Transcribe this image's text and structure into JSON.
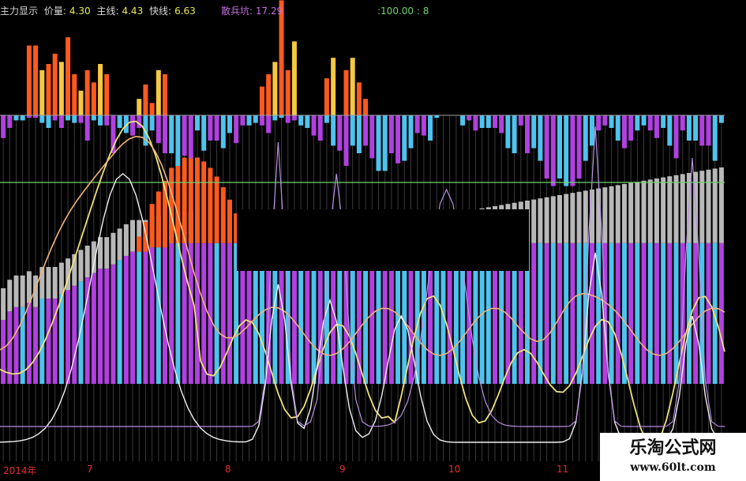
{
  "legend": {
    "title": "主力显示",
    "price_label": "价量:",
    "price_value": "4.30",
    "main_label": "主线:",
    "main_value": "4.43",
    "fast_label": "快线:",
    "fast_value": "6.63",
    "retail_label": "散兵坑:",
    "retail_value": "17.29",
    "ref_value": ":100.00 : 8"
  },
  "colors": {
    "background": "#000000",
    "bar_orange": "#ff5a1e",
    "bar_yellow": "#f5c842",
    "bar_cyan": "#4ec3ee",
    "bar_magenta": "#b040e0",
    "bar_gray": "#b8b8b8",
    "line_yellow": "#f0e27a",
    "line_peach": "#f2b47a",
    "line_white": "#f0f0f0",
    "line_violet": "#b890e0",
    "ref_line": "#6fd26f",
    "axis_labels": "#e03030"
  },
  "x_axis": {
    "labels": [
      "2014年",
      "7",
      "8",
      "9",
      "10",
      "11"
    ]
  },
  "watermark": {
    "line1": "乐淘公式网",
    "line2": "www.60lt.com"
  },
  "chart_data": {
    "type": "bar",
    "title": "主力显示",
    "n_bars": 112,
    "zero_line": 0,
    "ref_line": 100,
    "top_panel": {
      "description_series": "red/yellow bars above zero",
      "values": [
        0,
        0,
        0,
        0,
        34,
        34,
        22,
        25,
        30,
        26,
        38,
        20,
        12,
        22,
        16,
        25,
        20,
        0,
        0,
        0,
        0,
        8,
        15,
        6,
        22,
        20,
        0,
        0,
        0,
        0,
        0,
        0,
        0,
        0,
        0,
        0,
        0,
        0,
        0,
        0,
        14,
        20,
        26,
        56,
        22,
        36,
        0,
        0,
        0,
        0,
        18,
        28,
        0,
        22,
        28,
        16,
        8,
        0,
        0,
        0,
        0,
        0,
        0,
        0,
        0,
        0,
        0,
        0,
        0,
        0,
        0,
        0,
        0,
        0,
        0,
        0,
        0,
        0,
        0,
        0,
        0,
        0,
        0,
        0,
        0,
        0,
        0,
        0,
        0,
        0,
        0,
        0,
        0,
        0,
        0,
        0,
        0,
        0,
        0,
        0,
        0,
        0,
        0,
        0,
        0,
        0,
        0,
        0,
        0,
        0,
        0,
        0
      ]
    },
    "middle_panel": {
      "description_series": "cyan/magenta bars below zero",
      "values": [
        -18,
        -10,
        -4,
        -4,
        -2,
        -2,
        -6,
        -10,
        -4,
        -10,
        -4,
        -6,
        -6,
        -20,
        -4,
        -8,
        -8,
        -30,
        -10,
        -14,
        -16,
        -10,
        -24,
        -12,
        -22,
        -30,
        -30,
        -40,
        -32,
        -34,
        -12,
        -28,
        -20,
        -20,
        -26,
        -14,
        -22,
        -8,
        -8,
        -6,
        -8,
        -14,
        -4,
        -2,
        -6,
        -4,
        -8,
        -10,
        -16,
        -20,
        -6,
        -24,
        -28,
        -40,
        -24,
        -30,
        -24,
        -34,
        -44,
        -44,
        -30,
        -38,
        -36,
        -26,
        -14,
        -16,
        -20,
        -2,
        0,
        0,
        0,
        -8,
        -4,
        -12,
        -10,
        -10,
        -10,
        -14,
        -26,
        -30,
        -8,
        -30,
        -26,
        -36,
        -50,
        -56,
        -50,
        -56,
        -56,
        -50,
        -36,
        -24,
        -12,
        -8,
        -10,
        -20,
        -26,
        -20,
        -12,
        -8,
        -12,
        -18,
        -10,
        -24,
        -34,
        -12,
        -20,
        -20,
        -24,
        -24,
        -36,
        -6
      ]
    },
    "lower_panel": {
      "description_series": "colored volume-like bars",
      "values": [
        30,
        34,
        36,
        36,
        38,
        36,
        40,
        40,
        40,
        42,
        44,
        46,
        48,
        50,
        52,
        54,
        54,
        56,
        58,
        60,
        62,
        62,
        62,
        64,
        64,
        64,
        66,
        66,
        66,
        66,
        66,
        66,
        66,
        66,
        66,
        66,
        66,
        66,
        66,
        66,
        66,
        66,
        66,
        66,
        66,
        66,
        66,
        66,
        66,
        66,
        66,
        66,
        66,
        66,
        66,
        66,
        66,
        66,
        66,
        66,
        66,
        66,
        66,
        66,
        66,
        66,
        66,
        66,
        66,
        66,
        66,
        66,
        66,
        66,
        66,
        66,
        66,
        66,
        66,
        66,
        66,
        66,
        66,
        66,
        66,
        66,
        66,
        66,
        66,
        66,
        66,
        66,
        66,
        66,
        66,
        66,
        66,
        66,
        66,
        66,
        66,
        66,
        66,
        66,
        66,
        66,
        66,
        66,
        66,
        66,
        66,
        66
      ]
    }
  }
}
